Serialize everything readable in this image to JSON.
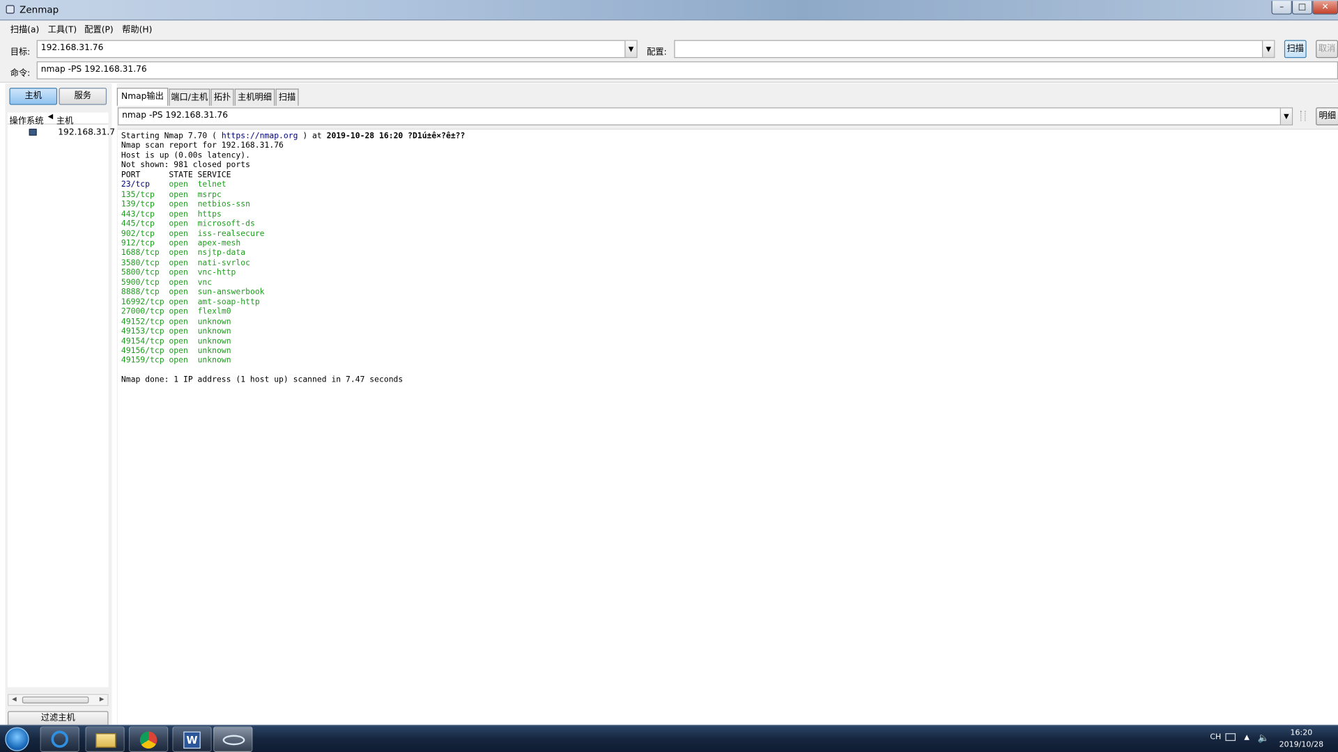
{
  "window": {
    "title": "Zenmap"
  },
  "menu": [
    "扫描(a)",
    "工具(T)",
    "配置(P)",
    "帮助(H)"
  ],
  "toolbar": {
    "target_label": "目标:",
    "target_value": "192.168.31.76",
    "profile_label": "配置:",
    "profile_value": "",
    "scan_button": "扫描",
    "cancel_button": "取消",
    "command_label": "命令:",
    "command_value": "nmap -PS 192.168.31.76"
  },
  "left_panel": {
    "tabs": [
      "主机",
      "服务"
    ],
    "columns": [
      "操作系统",
      "主机"
    ],
    "hosts": [
      {
        "address": "192.168.31.7"
      }
    ],
    "filter_button": "过滤主机"
  },
  "output_tabs": [
    "Nmap输出",
    "端口/主机",
    "拓扑",
    "主机明细",
    "扫描"
  ],
  "output_header": {
    "scan_select": "nmap -PS 192.168.31.76",
    "details_button": "明细"
  },
  "output": {
    "start_prefix": "Starting Nmap 7.70 ( ",
    "start_url": "https://nmap.org",
    "start_mid": " ) at ",
    "start_date": "2019-10-28 16:20 ?D1ú±ê×?ê±??",
    "report_line": "Nmap scan report for 192.168.31.76",
    "host_up": "Host is up (0.00s latency).",
    "not_shown": "Not shown: 981 closed ports",
    "table_header": "PORT      STATE SERVICE",
    "ports": [
      {
        "port": "23/tcp",
        "state": "open",
        "service": "telnet"
      },
      {
        "port": "135/tcp",
        "state": "open",
        "service": "msrpc"
      },
      {
        "port": "139/tcp",
        "state": "open",
        "service": "netbios-ssn"
      },
      {
        "port": "443/tcp",
        "state": "open",
        "service": "https"
      },
      {
        "port": "445/tcp",
        "state": "open",
        "service": "microsoft-ds"
      },
      {
        "port": "902/tcp",
        "state": "open",
        "service": "iss-realsecure"
      },
      {
        "port": "912/tcp",
        "state": "open",
        "service": "apex-mesh"
      },
      {
        "port": "1688/tcp",
        "state": "open",
        "service": "nsjtp-data"
      },
      {
        "port": "3580/tcp",
        "state": "open",
        "service": "nati-svrloc"
      },
      {
        "port": "5800/tcp",
        "state": "open",
        "service": "vnc-http"
      },
      {
        "port": "5900/tcp",
        "state": "open",
        "service": "vnc"
      },
      {
        "port": "8888/tcp",
        "state": "open",
        "service": "sun-answerbook"
      },
      {
        "port": "16992/tcp",
        "state": "open",
        "service": "amt-soap-http"
      },
      {
        "port": "27000/tcp",
        "state": "open",
        "service": "flexlm0"
      },
      {
        "port": "49152/tcp",
        "state": "open",
        "service": "unknown"
      },
      {
        "port": "49153/tcp",
        "state": "open",
        "service": "unknown"
      },
      {
        "port": "49154/tcp",
        "state": "open",
        "service": "unknown"
      },
      {
        "port": "49156/tcp",
        "state": "open",
        "service": "unknown"
      },
      {
        "port": "49159/tcp",
        "state": "open",
        "service": "unknown"
      }
    ],
    "done_line": "Nmap done: 1 IP address (1 host up) scanned in 7.47 seconds"
  },
  "taskbar": {
    "lang": "CH",
    "time": "16:20",
    "date": "2019/10/28"
  }
}
